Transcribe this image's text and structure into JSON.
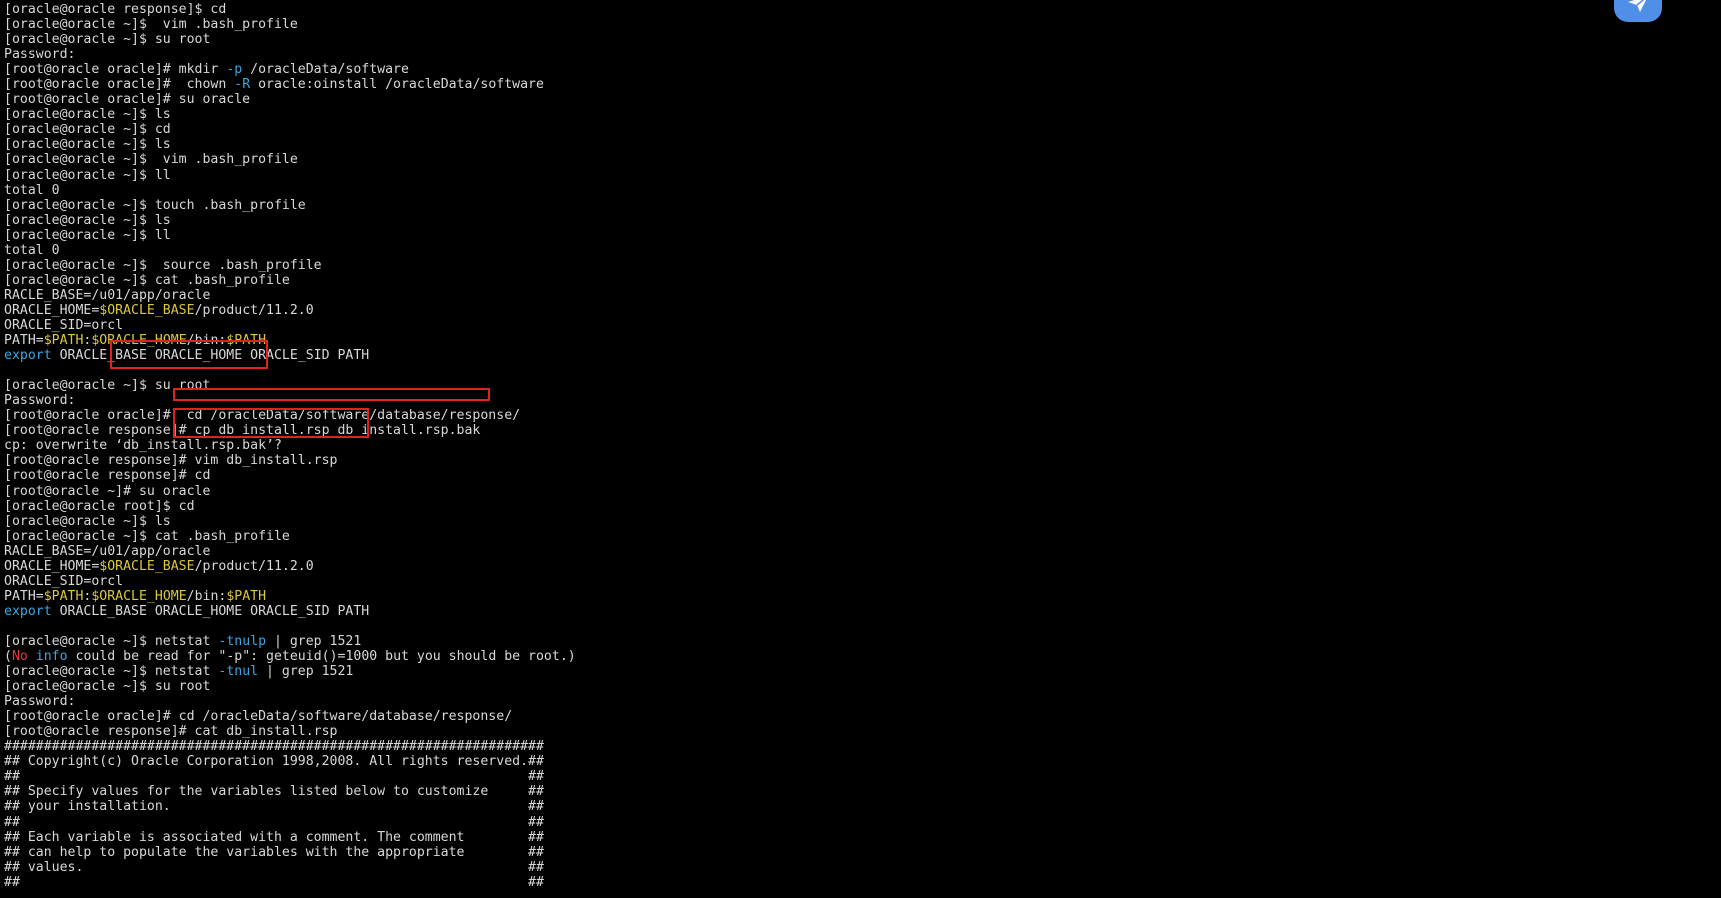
{
  "terminal": {
    "lines": [
      [
        {
          "t": "[oracle@oracle response]$ cd"
        }
      ],
      [
        {
          "t": "[oracle@oracle ~]$  vim .bash_profile"
        }
      ],
      [
        {
          "t": "[oracle@oracle ~]$ su root"
        }
      ],
      [
        {
          "t": "Password:"
        }
      ],
      [
        {
          "t": "[root@oracle oracle]# mkdir "
        },
        {
          "t": "-p",
          "c": "cyan"
        },
        {
          "t": " /oracleData/software"
        }
      ],
      [
        {
          "t": "[root@oracle oracle]#  chown "
        },
        {
          "t": "-R",
          "c": "cyan"
        },
        {
          "t": " oracle:oinstall /oracleData/software"
        }
      ],
      [
        {
          "t": "[root@oracle oracle]# su oracle"
        }
      ],
      [
        {
          "t": "[oracle@oracle ~]$ ls"
        }
      ],
      [
        {
          "t": "[oracle@oracle ~]$ cd"
        }
      ],
      [
        {
          "t": "[oracle@oracle ~]$ ls"
        }
      ],
      [
        {
          "t": "[oracle@oracle ~]$  vim .bash_profile"
        }
      ],
      [
        {
          "t": "[oracle@oracle ~]$ ll"
        }
      ],
      [
        {
          "t": "total 0"
        }
      ],
      [
        {
          "t": "[oracle@oracle ~]$ touch .bash_profile"
        }
      ],
      [
        {
          "t": "[oracle@oracle ~]$ ls"
        }
      ],
      [
        {
          "t": "[oracle@oracle ~]$ ll"
        }
      ],
      [
        {
          "t": "total 0"
        }
      ],
      [
        {
          "t": "[oracle@oracle ~]$  source .bash_profile"
        }
      ],
      [
        {
          "t": "[oracle@oracle ~]$ cat .bash_profile"
        }
      ],
      [
        {
          "t": "RACLE_BASE=/u01/app/oracle"
        }
      ],
      [
        {
          "t": "ORACLE_HOME="
        },
        {
          "t": "$ORACLE_BASE",
          "c": "yellow"
        },
        {
          "t": "/product/11.2.0"
        }
      ],
      [
        {
          "t": "ORACLE_SID=orcl"
        }
      ],
      [
        {
          "t": "PATH="
        },
        {
          "t": "$PATH",
          "c": "yellow"
        },
        {
          "t": ":"
        },
        {
          "t": "$ORACLE_HOME",
          "c": "yellow"
        },
        {
          "t": "/bin:"
        },
        {
          "t": "$PATH",
          "c": "yellow"
        }
      ],
      [
        {
          "t": "export",
          "c": "cyan"
        },
        {
          "t": " ORACLE_BASE ORACLE_HOME ORACLE_SID PATH"
        }
      ],
      [
        {
          "t": ""
        }
      ],
      [
        {
          "t": "[oracle@oracle ~]$ su root"
        }
      ],
      [
        {
          "t": "Password:"
        }
      ],
      [
        {
          "t": "[root@oracle oracle]#  cd /oracleData/software/database/response/"
        }
      ],
      [
        {
          "t": "[root@oracle response]# cp db_install.rsp db_install.rsp.bak"
        }
      ],
      [
        {
          "t": "cp: overwrite ‘db_install.rsp.bak’?"
        }
      ],
      [
        {
          "t": "[root@oracle response]# vim db_install.rsp"
        }
      ],
      [
        {
          "t": "[root@oracle response]# cd"
        }
      ],
      [
        {
          "t": "[root@oracle ~]# su oracle"
        }
      ],
      [
        {
          "t": "[oracle@oracle root]$ cd"
        }
      ],
      [
        {
          "t": "[oracle@oracle ~]$ ls"
        }
      ],
      [
        {
          "t": "[oracle@oracle ~]$ cat .bash_profile"
        }
      ],
      [
        {
          "t": "RACLE_BASE=/u01/app/oracle"
        }
      ],
      [
        {
          "t": "ORACLE_HOME="
        },
        {
          "t": "$ORACLE_BASE",
          "c": "yellow"
        },
        {
          "t": "/product/11.2.0"
        }
      ],
      [
        {
          "t": "ORACLE_SID=orcl"
        }
      ],
      [
        {
          "t": "PATH="
        },
        {
          "t": "$PATH",
          "c": "yellow"
        },
        {
          "t": ":"
        },
        {
          "t": "$ORACLE_HOME",
          "c": "yellow"
        },
        {
          "t": "/bin:"
        },
        {
          "t": "$PATH",
          "c": "yellow"
        }
      ],
      [
        {
          "t": "export",
          "c": "cyan"
        },
        {
          "t": " ORACLE_BASE ORACLE_HOME ORACLE_SID PATH"
        }
      ],
      [
        {
          "t": ""
        }
      ],
      [
        {
          "t": "[oracle@oracle ~]$ netstat "
        },
        {
          "t": "-tnulp",
          "c": "cyan"
        },
        {
          "t": " | grep 1521"
        }
      ],
      [
        {
          "t": "("
        },
        {
          "t": "No",
          "c": "red"
        },
        {
          "t": " "
        },
        {
          "t": "info",
          "c": "cyan"
        },
        {
          "t": " could be read for \"-p\": geteuid()=1000 but you should be root.)"
        }
      ],
      [
        {
          "t": "[oracle@oracle ~]$ netstat "
        },
        {
          "t": "-tnul",
          "c": "cyan"
        },
        {
          "t": " | grep 1521"
        }
      ],
      [
        {
          "t": "[oracle@oracle ~]$ su root"
        }
      ],
      [
        {
          "t": "Password:"
        }
      ],
      [
        {
          "t": "[root@oracle oracle]# cd /oracleData/software/database/response/"
        }
      ],
      [
        {
          "t": "[root@oracle response]# cat db_install.rsp"
        }
      ],
      [
        {
          "t": "####################################################################"
        }
      ],
      [
        {
          "t": "## Copyright(c) Oracle Corporation 1998,2008. All rights reserved.##"
        }
      ],
      [
        {
          "t": "##                                                                ##"
        }
      ],
      [
        {
          "t": "## Specify values for the variables listed below to customize     ##"
        }
      ],
      [
        {
          "t": "## your installation.                                             ##"
        }
      ],
      [
        {
          "t": "##                                                                ##"
        }
      ],
      [
        {
          "t": "## Each variable is associated with a comment. The comment        ##"
        }
      ],
      [
        {
          "t": "## can help to populate the variables with the appropriate        ##"
        }
      ],
      [
        {
          "t": "## values.                                                        ##"
        }
      ],
      [
        {
          "t": "##                                                                ##"
        }
      ]
    ]
  },
  "colors": {
    "background": "#000000",
    "text": "#d8d8d8",
    "yellow": "#d8c83a",
    "cyan": "#3aa6e0",
    "red": "#e03a3a",
    "highlight_box": "#e0211e",
    "app_icon": "#4f8fe8"
  },
  "icons": {
    "app_icon": "paper-plane-icon"
  }
}
